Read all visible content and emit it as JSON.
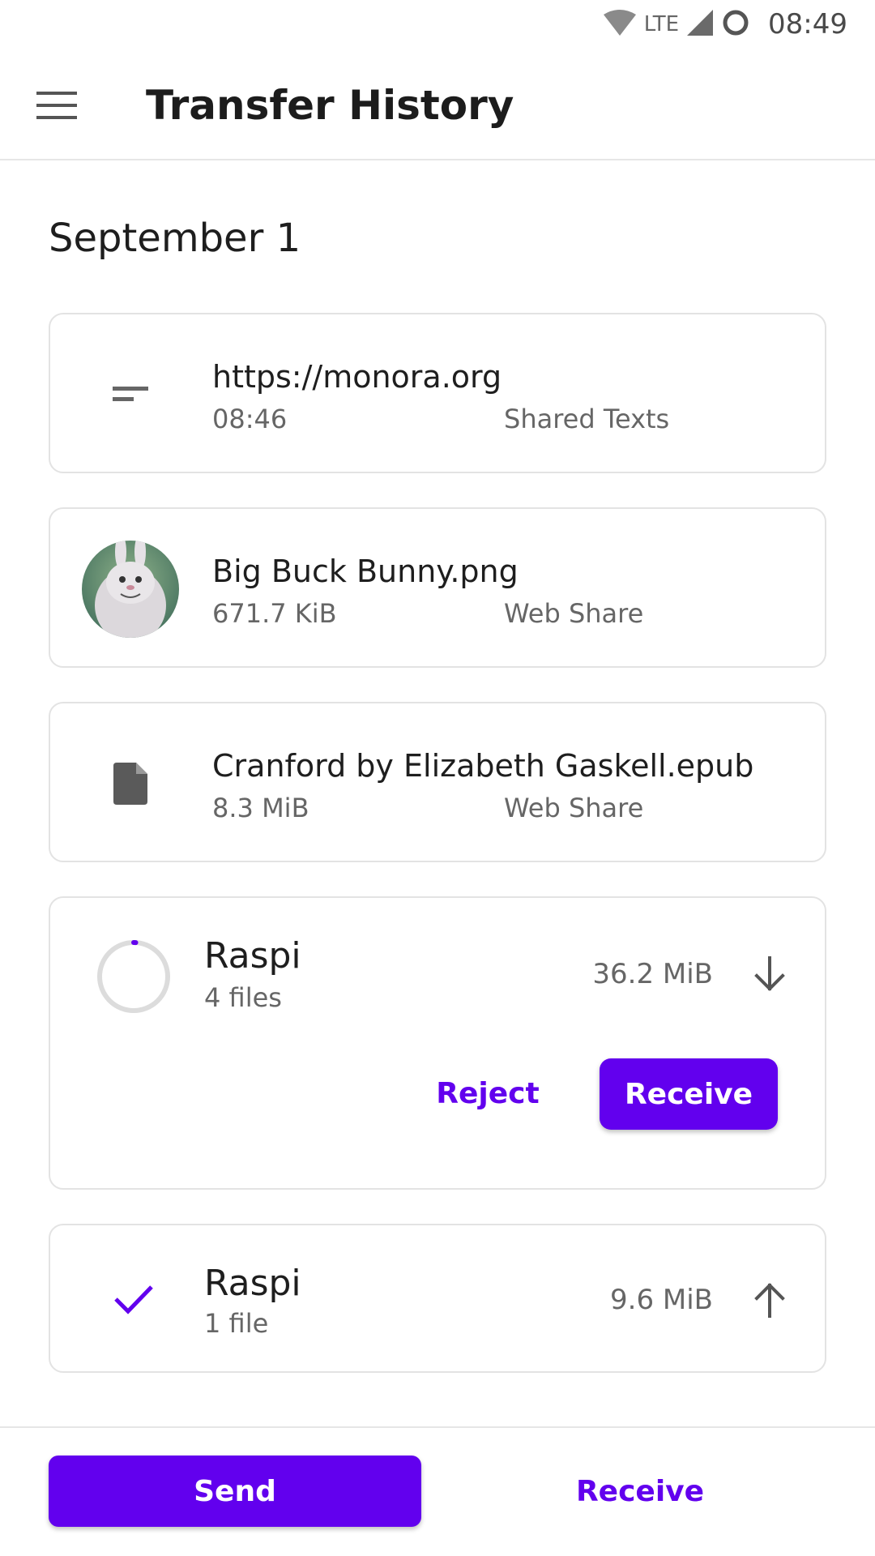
{
  "status_bar": {
    "network": "LTE",
    "time": "08:49"
  },
  "app_bar": {
    "title": "Transfer History",
    "menu_icon": "hamburger-menu-icon"
  },
  "section": {
    "date": "September 1"
  },
  "items": [
    {
      "icon": "short-text-icon",
      "title": "https://monora.org",
      "subtitle": "08:46",
      "tag": "Shared Texts"
    },
    {
      "icon": "image-thumbnail",
      "title": "Big Buck Bunny.png",
      "subtitle": "671.7 KiB",
      "tag": "Web Share"
    },
    {
      "icon": "file-icon",
      "title": "Cranford by Elizabeth Gaskell.epub",
      "subtitle": "8.3 MiB",
      "tag": "Web Share"
    }
  ],
  "transfers": [
    {
      "device": "Raspi",
      "files": "4 files",
      "size": "36.2 MiB",
      "direction": "incoming",
      "state": "pending",
      "progress": 0.01,
      "reject_label": "Reject",
      "receive_label": "Receive"
    },
    {
      "device": "Raspi",
      "files": "1 file",
      "size": "9.6 MiB",
      "direction": "outgoing",
      "state": "completed"
    }
  ],
  "bottom": {
    "send_label": "Send",
    "receive_label": "Receive"
  },
  "colors": {
    "accent": "#6200ee",
    "text_primary": "#1e1e1e",
    "text_secondary": "#666666",
    "border": "#e3e3e3"
  }
}
